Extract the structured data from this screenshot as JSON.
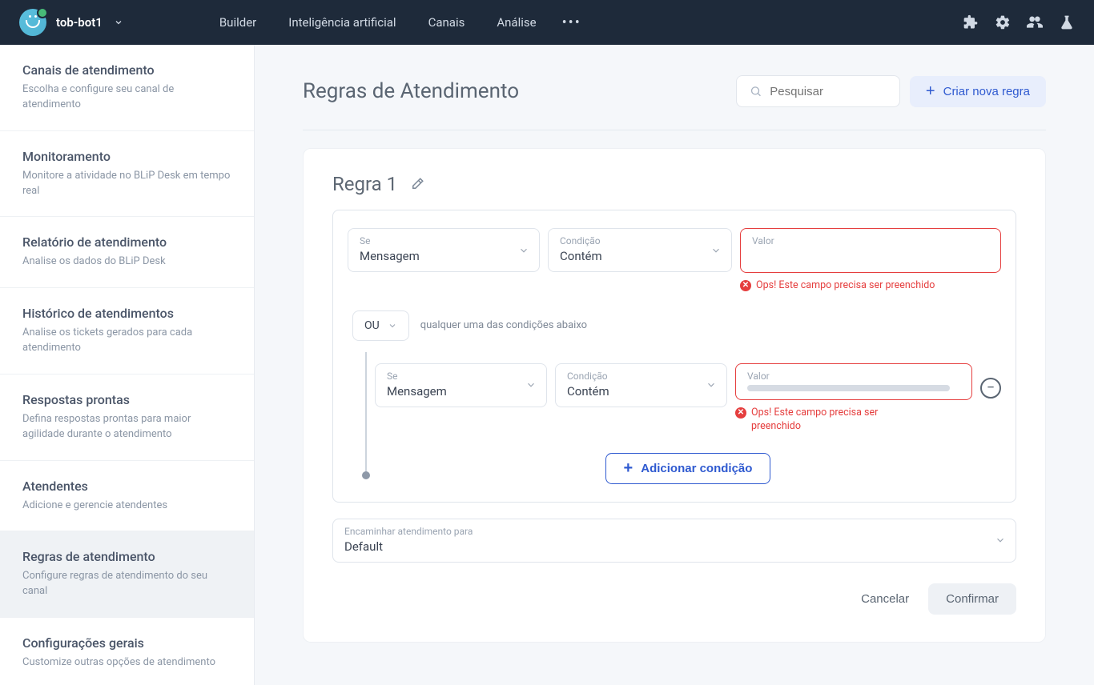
{
  "header": {
    "botName": "tob-bot1",
    "nav": [
      "Builder",
      "Inteligência artificial",
      "Canais",
      "Análise"
    ]
  },
  "sidebar": {
    "items": [
      {
        "title": "Canais de atendimento",
        "desc": "Escolha e configure seu canal de atendimento"
      },
      {
        "title": "Monitoramento",
        "desc": "Monitore a atividade no BLiP Desk em tempo real"
      },
      {
        "title": "Relatório de atendimento",
        "desc": "Analise os dados do BLiP Desk"
      },
      {
        "title": "Histórico de atendimentos",
        "desc": "Analise os tickets gerados para cada atendimento"
      },
      {
        "title": "Respostas prontas",
        "desc": "Defina respostas prontas para maior agilidade durante o atendimento"
      },
      {
        "title": "Atendentes",
        "desc": "Adicione e gerencie atendentes"
      },
      {
        "title": "Regras de atendimento",
        "desc": "Configure regras de atendimento do seu canal"
      },
      {
        "title": "Configurações gerais",
        "desc": "Customize outras opções de atendimento"
      }
    ],
    "activeIndex": 6
  },
  "page": {
    "title": "Regras de Atendimento",
    "searchPlaceholder": "Pesquisar",
    "createButton": "Criar nova regra"
  },
  "rule": {
    "name": "Regra 1",
    "labels": {
      "if": "Se",
      "condition": "Condição",
      "value": "Valor",
      "forward": "Encaminhar atendimento para"
    },
    "operator": {
      "value": "OU",
      "hint": "qualquer uma das condições abaixo"
    },
    "conditions": [
      {
        "if": "Mensagem",
        "condition": "Contém",
        "value": "",
        "error": "Ops! Este campo precisa ser preenchido"
      },
      {
        "if": "Mensagem",
        "condition": "Contém",
        "value": "",
        "error": "Ops! Este campo precisa ser preenchido"
      }
    ],
    "addCondition": "Adicionar condição",
    "forwardTo": "Default",
    "actions": {
      "cancel": "Cancelar",
      "confirm": "Confirmar"
    }
  }
}
